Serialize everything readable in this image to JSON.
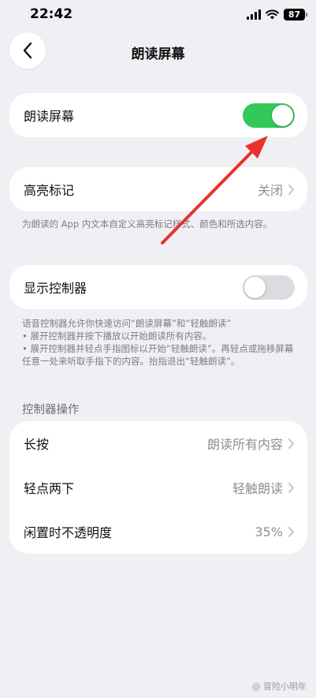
{
  "status_bar": {
    "time": "22:42",
    "battery": "87"
  },
  "nav": {
    "title": "朗读屏幕"
  },
  "speak_screen": {
    "label": "朗读屏幕",
    "enabled": true
  },
  "highlight": {
    "label": "高亮标记",
    "value": "关闭",
    "footnote": "为朗读的 App 内文本自定义高亮标记样式、颜色和所选内容。"
  },
  "controller": {
    "label": "显示控制器",
    "enabled": false,
    "footnote_lines": [
      "语音控制器允许你快速访问“朗读屏幕”和“轻触朗读”",
      "• 展开控制器并按下播放以开始朗读所有内容。",
      "• 展开控制器并轻点手指图标以开始“轻触朗读”。再轻点或拖移屏幕任意一处来听取手指下的内容。抬指退出“轻触朗读”。"
    ]
  },
  "actions": {
    "header": "控制器操作",
    "rows": [
      {
        "label": "长按",
        "value": "朗读所有内容"
      },
      {
        "label": "轻点两下",
        "value": "轻触朗读"
      },
      {
        "label": "闲置时不透明度",
        "value": "35%"
      }
    ]
  },
  "watermark": {
    "text": "@ 冒险小明年"
  },
  "colors": {
    "accent_green": "#34c759",
    "annotation_red": "#e8322b"
  }
}
